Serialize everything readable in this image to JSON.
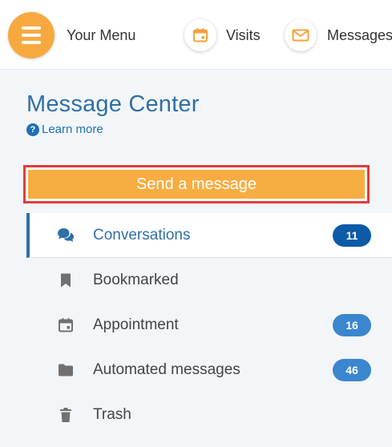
{
  "header": {
    "menu_label": "Your Menu",
    "visits_label": "Visits",
    "messages_label": "Messages"
  },
  "message_center": {
    "title": "Message Center",
    "learn_more": "Learn more",
    "send_button": "Send a message"
  },
  "folders": [
    {
      "label": "Conversations",
      "badge": "11",
      "icon": "chat-bubbles-icon",
      "active": true
    },
    {
      "label": "Bookmarked",
      "badge": "",
      "icon": "bookmark-icon",
      "active": false
    },
    {
      "label": "Appointment",
      "badge": "16",
      "icon": "calendar-icon",
      "active": false
    },
    {
      "label": "Automated messages",
      "badge": "46",
      "icon": "folder-icon",
      "active": false
    },
    {
      "label": "Trash",
      "badge": "",
      "icon": "trash-icon",
      "active": false
    }
  ],
  "colors": {
    "accent_orange": "#f7ad41",
    "primary_blue": "#2f6fa6",
    "badge_active": "#0d5aa7",
    "badge_default": "#3a86cf",
    "highlight_red": "#e03c3c"
  }
}
